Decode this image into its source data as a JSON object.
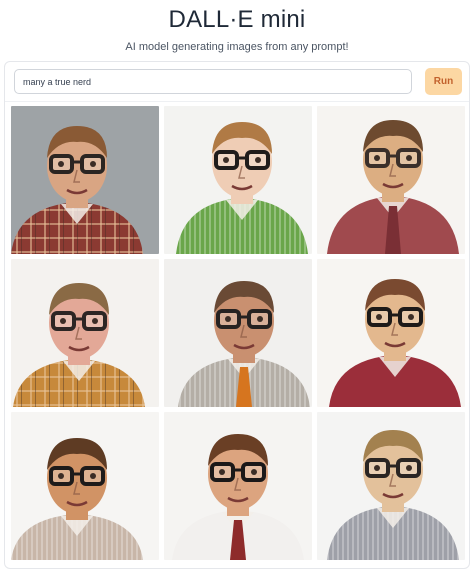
{
  "header": {
    "title": "DALL·E mini",
    "subtitle": "AI model generating images from any prompt!"
  },
  "prompt": {
    "value": "many a true nerd",
    "run_label": "Run"
  },
  "images": [
    {
      "bg": "#9ea3a6",
      "skin": "#d9a583",
      "hair": "#8a5a35",
      "shirt": "#8b3a32",
      "tie": null,
      "pattern": "plaid",
      "glasses": "#2b2522"
    },
    {
      "bg": "#f3f3f1",
      "skin": "#efcdb5",
      "hair": "#b07a45",
      "shirt": "#6aa64a",
      "tie": null,
      "pattern": "stripe",
      "glasses": "#1f1c1b"
    },
    {
      "bg": "#f6f4f1",
      "skin": "#dcae82",
      "hair": "#6d4a2f",
      "shirt": "#a04a4e",
      "tie": "#7a2f35",
      "pattern": "plain",
      "glasses": "#3a2f2a"
    },
    {
      "bg": "#f4f2ef",
      "skin": "#e3a897",
      "hair": "#8a6a45",
      "shirt": "#c7893b",
      "tie": null,
      "pattern": "plaid",
      "glasses": "#2d2624"
    },
    {
      "bg": "#f1f0ee",
      "skin": "#c99070",
      "hair": "#6a4a35",
      "shirt": "#b4aea6",
      "tie": "#d6751f",
      "pattern": "stripe",
      "glasses": "#262221"
    },
    {
      "bg": "#f7f5f2",
      "skin": "#e3b88e",
      "hair": "#7a4a30",
      "shirt": "#9b2e3a",
      "tie": null,
      "pattern": "plain",
      "glasses": "#1d1a19"
    },
    {
      "bg": "#f6f5f3",
      "skin": "#d19365",
      "hair": "#5e3b23",
      "shirt": "#c8b6a8",
      "tie": null,
      "pattern": "stripe",
      "glasses": "#1e1b1a"
    },
    {
      "bg": "#f5f4f2",
      "skin": "#dca47f",
      "hair": "#6a3f25",
      "shirt": "#f2f0ee",
      "tie": "#8e2b2b",
      "pattern": "plain",
      "glasses": "#1b1818"
    },
    {
      "bg": "#f4f4f3",
      "skin": "#e3c19b",
      "hair": "#a3814f",
      "shirt": "#9ea0a8",
      "tie": null,
      "pattern": "stripe",
      "glasses": "#2a2523"
    }
  ]
}
